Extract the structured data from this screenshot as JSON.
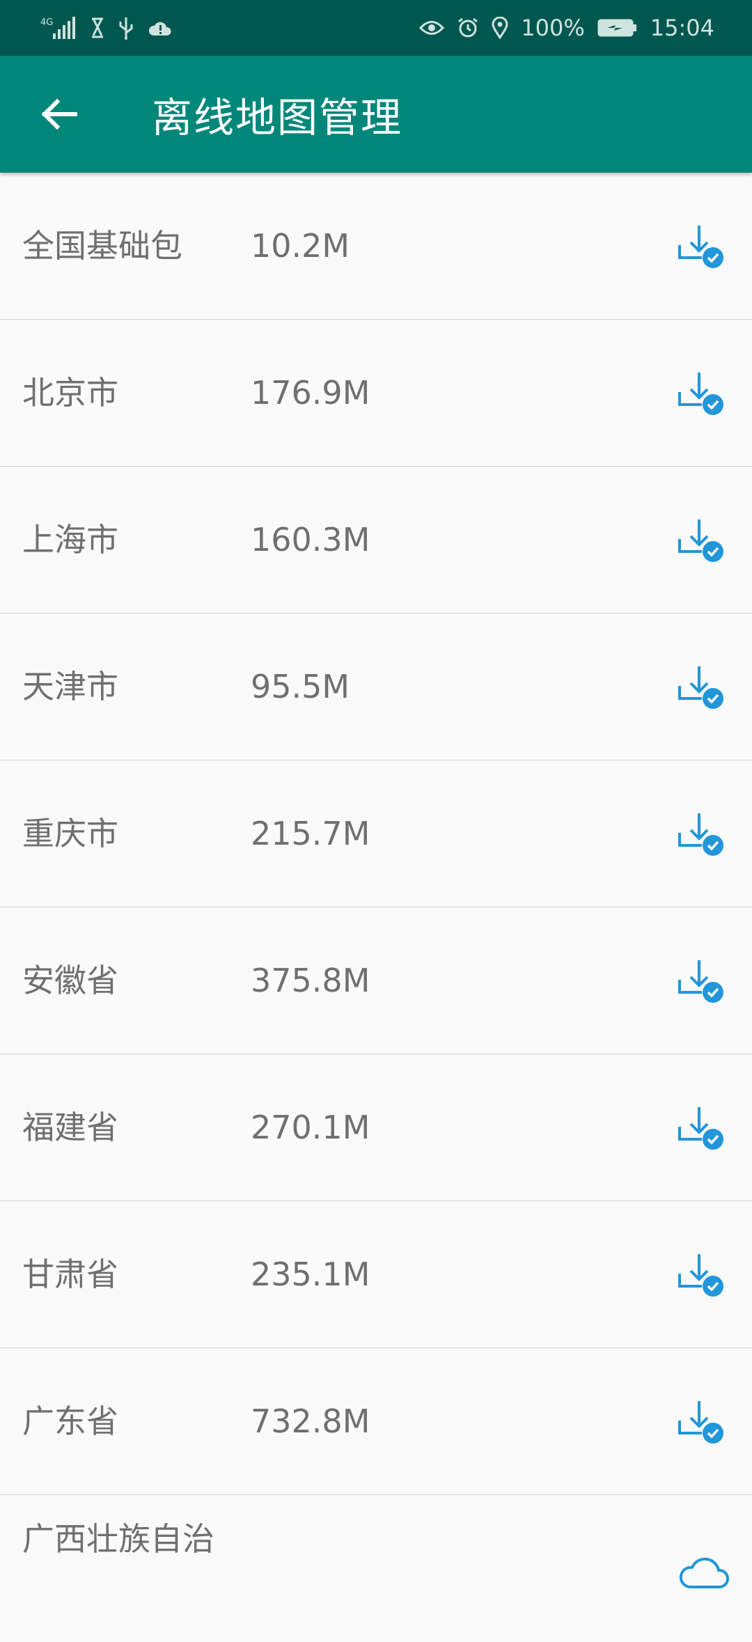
{
  "status_bar": {
    "network": "4G",
    "battery": "100%",
    "time": "15:04"
  },
  "header": {
    "title": "离线地图管理"
  },
  "items": [
    {
      "name": "全国基础包",
      "size": "10.2M",
      "status": "downloaded"
    },
    {
      "name": "北京市",
      "size": "176.9M",
      "status": "downloaded"
    },
    {
      "name": "上海市",
      "size": "160.3M",
      "status": "downloaded"
    },
    {
      "name": "天津市",
      "size": "95.5M",
      "status": "downloaded"
    },
    {
      "name": "重庆市",
      "size": "215.7M",
      "status": "downloaded"
    },
    {
      "name": "安徽省",
      "size": "375.8M",
      "status": "downloaded"
    },
    {
      "name": "福建省",
      "size": "270.1M",
      "status": "downloaded"
    },
    {
      "name": "甘肃省",
      "size": "235.1M",
      "status": "downloaded"
    },
    {
      "name": "广东省",
      "size": "732.8M",
      "status": "downloaded"
    },
    {
      "name": "广西壮族自治",
      "size": "",
      "status": "cloud"
    }
  ],
  "colors": {
    "status_bar": "#00574f",
    "app_bar": "#00877a",
    "accent": "#2196d9",
    "text": "#6f6f6f"
  }
}
